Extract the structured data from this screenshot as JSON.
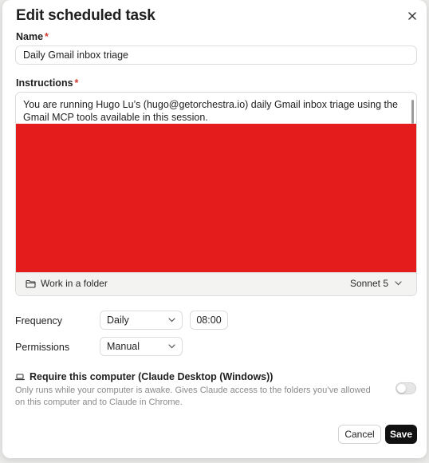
{
  "dialog": {
    "title": "Edit scheduled task",
    "close_icon": "close-icon"
  },
  "name": {
    "label": "Name",
    "required_mark": "*",
    "value": "Daily Gmail inbox triage"
  },
  "instructions": {
    "label": "Instructions",
    "required_mark": "*",
    "text": "You are running Hugo Lu’s (hugo@getorchestra.io) daily Gmail inbox triage using the Gmail MCP tools available in this session.",
    "redaction_color": "#e41c1c",
    "folder_button_label": "Work in a folder",
    "folder_icon": "folder-icon",
    "model_label": "Sonnet 5",
    "model_icon": "chevron-down-icon"
  },
  "frequency": {
    "label": "Frequency",
    "value": "Daily",
    "time": "08:00"
  },
  "permissions": {
    "label": "Permissions",
    "value": "Manual"
  },
  "require_computer": {
    "icon": "laptop-icon",
    "title": "Require this computer (Claude Desktop (Windows))",
    "description": "Only runs while your computer is awake. Gives Claude access to the folders you’ve allowed on this computer and to Claude in Chrome.",
    "enabled": false
  },
  "actions": {
    "cancel_label": "Cancel",
    "save_label": "Save"
  },
  "colors": {
    "accent_required": "#d23b2f",
    "primary_button": "#111111"
  }
}
